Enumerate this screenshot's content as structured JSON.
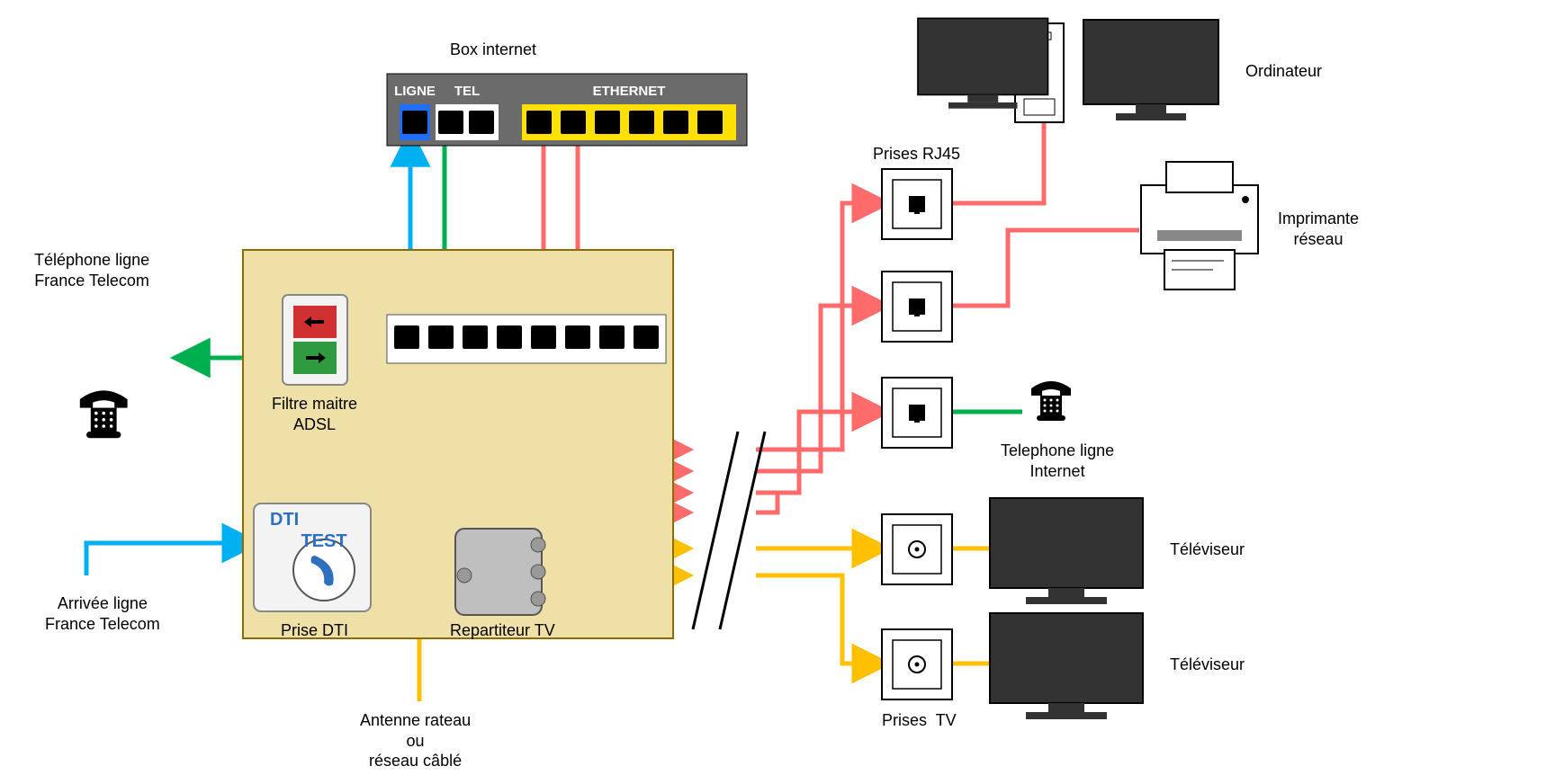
{
  "labels": {
    "box_internet": "Box internet",
    "box_ligne": "LIGNE",
    "box_tel": "TEL",
    "box_eth": "ETHERNET",
    "tel_ft": "Téléphone ligne\nFrance Telecom",
    "arrivee": "Arrivée ligne\nFrance Telecom",
    "filtre": "Filtre maitre\nADSL",
    "prise_dti": "Prise DTI",
    "dti": "DTI",
    "test": "TEST",
    "repartiteur": "Repartiteur TV",
    "antenne": "Antenne rateau\nou\nréseau câblé",
    "prises_rj45": "Prises RJ45",
    "prises_tv": "Prises  TV",
    "ordinateur": "Ordinateur",
    "imprimante": "Imprimante\nréseau",
    "tel_internet": "Telephone ligne\nInternet",
    "televiseur": "Téléviseur",
    "colors": {
      "blue": "#00b0f0",
      "green": "#00b050",
      "red": "#ff6b6b",
      "yellow": "#ffc000"
    }
  }
}
